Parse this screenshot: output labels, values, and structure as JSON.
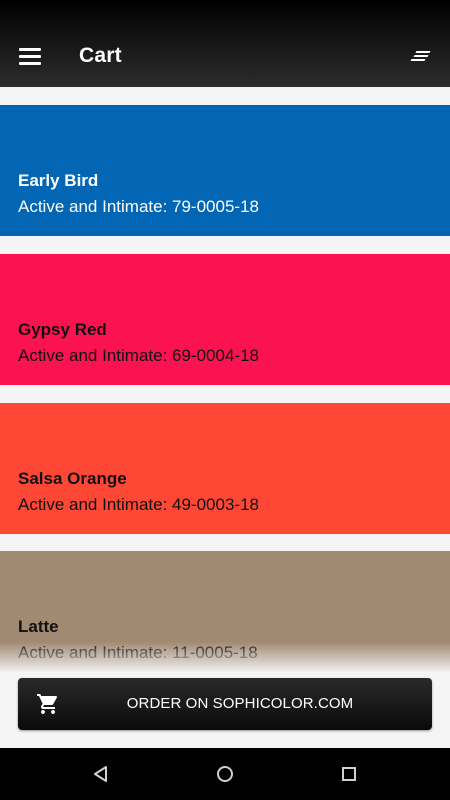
{
  "header": {
    "title": "Cart",
    "menu_icon": "hamburger-menu-icon",
    "sort_icon": "sort-lines-icon"
  },
  "cart": {
    "items": [
      {
        "name": "Early Bird",
        "code": "Active and Intimate: 79-0005-18",
        "color": "#0366b4",
        "text_color": "light"
      },
      {
        "name": "Gypsy Red",
        "code": "Active and Intimate: 69-0004-18",
        "color": "#fb1250",
        "text_color": "dark"
      },
      {
        "name": "Salsa Orange",
        "code": "Active and Intimate: 49-0003-18",
        "color": "#fe4734",
        "text_color": "dark"
      },
      {
        "name": "Latte",
        "code": "Active and Intimate: 11-0005-18",
        "color": "#a18a72",
        "text_color": "dark"
      }
    ]
  },
  "order_button": {
    "label": "ORDER ON SOPHICOLOR.COM",
    "icon": "shopping-cart-icon"
  },
  "system_nav": {
    "back_icon": "back-triangle-icon",
    "home_icon": "home-circle-icon",
    "recents_icon": "recents-square-icon"
  }
}
